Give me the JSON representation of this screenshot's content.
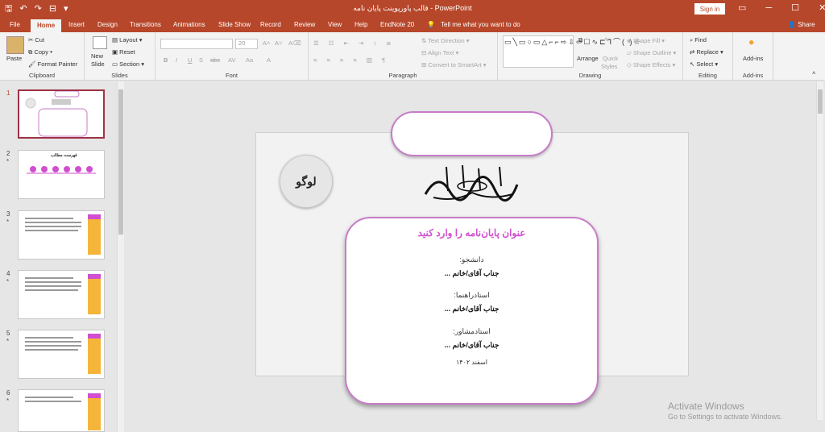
{
  "titlebar": {
    "title": "قالب پاورپوینت پایان نامه  -  PowerPoint",
    "signin": "Sign in",
    "qa_icons": [
      "save-icon",
      "undo-icon",
      "redo-icon",
      "present-icon",
      "customize-icon"
    ],
    "win_controls": [
      "▭",
      "─",
      "☐",
      "✕"
    ]
  },
  "tabs": [
    "File",
    "Home",
    "Insert",
    "Design",
    "Transitions",
    "Animations",
    "Slide Show",
    "Record",
    "Review",
    "View",
    "Help",
    "EndNote 20"
  ],
  "active_tab": "Home",
  "tell_me": "Tell me what you want to do",
  "share": "Share",
  "ribbon": {
    "clipboard": {
      "paste": "Paste",
      "cut": "Cut",
      "copy": "Copy",
      "format_painter": "Format Painter",
      "label": "Clipboard"
    },
    "slides": {
      "new_slide": "New",
      "new_slide2": "Slide",
      "layout": "Layout",
      "reset": "Reset",
      "section": "Section",
      "label": "Slides"
    },
    "font": {
      "size": "20",
      "label": "Font",
      "buttons": [
        "B",
        "I",
        "U",
        "S",
        "abc",
        "AV",
        "Aa",
        "A"
      ]
    },
    "paragraph": {
      "text_direction": "Text Direction",
      "align_text": "Align Text",
      "convert": "Convert to SmartArt",
      "label": "Paragraph"
    },
    "drawing": {
      "arrange": "Arrange",
      "quick_styles": "Quick",
      "quick_styles2": "Styles",
      "shape_fill": "Shape Fill",
      "shape_outline": "Shape Outline",
      "shape_effects": "Shape Effects",
      "label": "Drawing"
    },
    "editing": {
      "find": "Find",
      "replace": "Replace",
      "select": "Select",
      "label": "Editing"
    },
    "addins": {
      "addins": "Add-ins",
      "label": "Add-ins"
    }
  },
  "thumbnails": [
    {
      "num": "1",
      "star": ""
    },
    {
      "num": "2",
      "star": "*"
    },
    {
      "num": "3",
      "star": "*"
    },
    {
      "num": "4",
      "star": "*"
    },
    {
      "num": "5",
      "star": "*"
    },
    {
      "num": "6",
      "star": "*"
    }
  ],
  "thumb2_title": "فهرست مطالب",
  "slide": {
    "logo": "لوگو",
    "title": "عنوان پایان‌نامه را وارد کنید",
    "student_label": "دانشجو:",
    "student_value": "جناب آقای/خانم ...",
    "advisor_label": "استادراهنما:",
    "advisor_value": "جناب آقای/خانم ...",
    "consultant_label": "استادمشاور:",
    "consultant_value": "جناب آقای/خانم ...",
    "date": "اسفند ۱۴۰۲"
  },
  "watermark": {
    "line1": "Activate Windows",
    "line2": "Go to Settings to activate Windows."
  },
  "colors": {
    "accent": "#b7472a",
    "pink": "#d04fd0",
    "border": "#c77cc7"
  }
}
